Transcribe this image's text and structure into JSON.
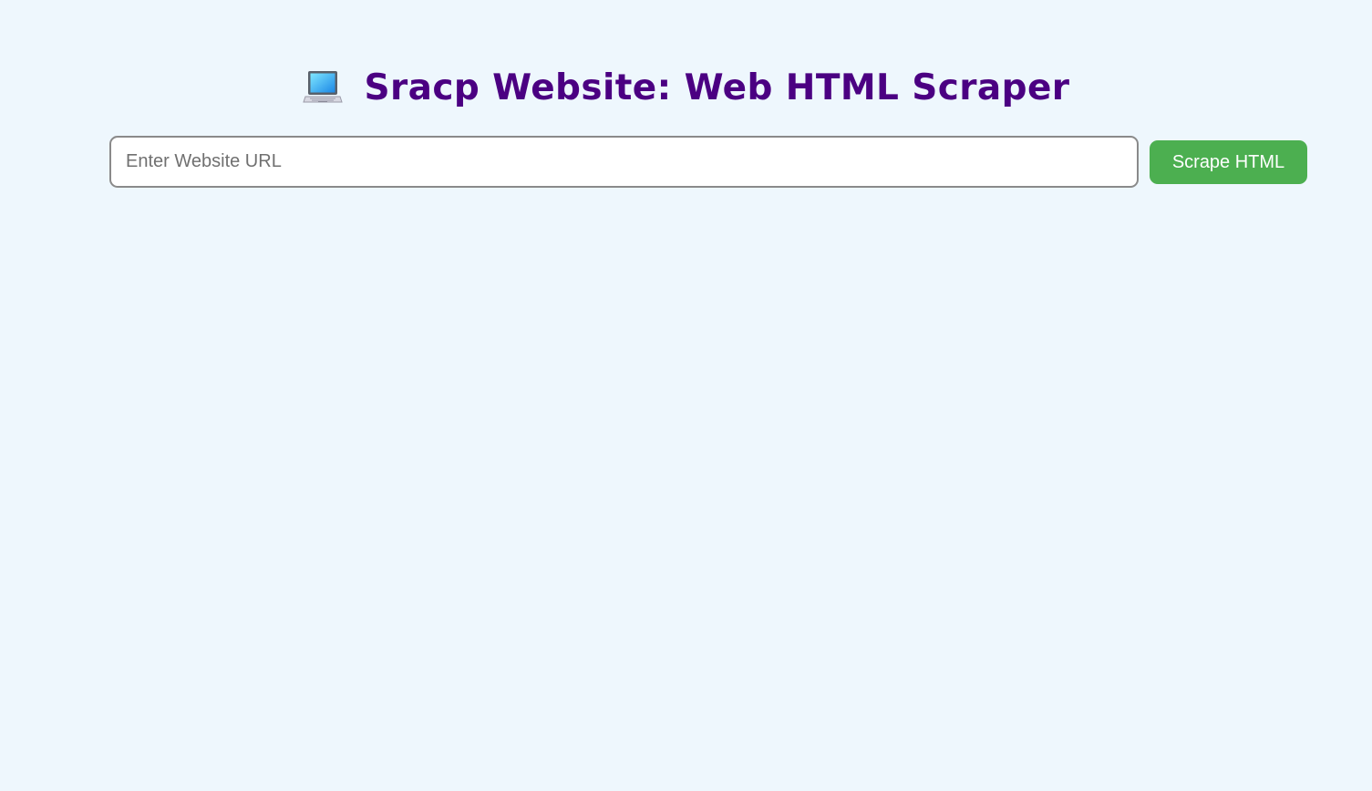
{
  "header": {
    "icon": "laptop-icon",
    "title": "Sracp Website: Web HTML Scraper"
  },
  "form": {
    "url_placeholder": "Enter Website URL",
    "url_value": "",
    "submit_label": "Scrape HTML"
  },
  "colors": {
    "background": "#eef7fd",
    "title": "#4b0082",
    "button": "#4caf50",
    "button_text": "#ffffff",
    "input_border": "#8a8a8a"
  }
}
